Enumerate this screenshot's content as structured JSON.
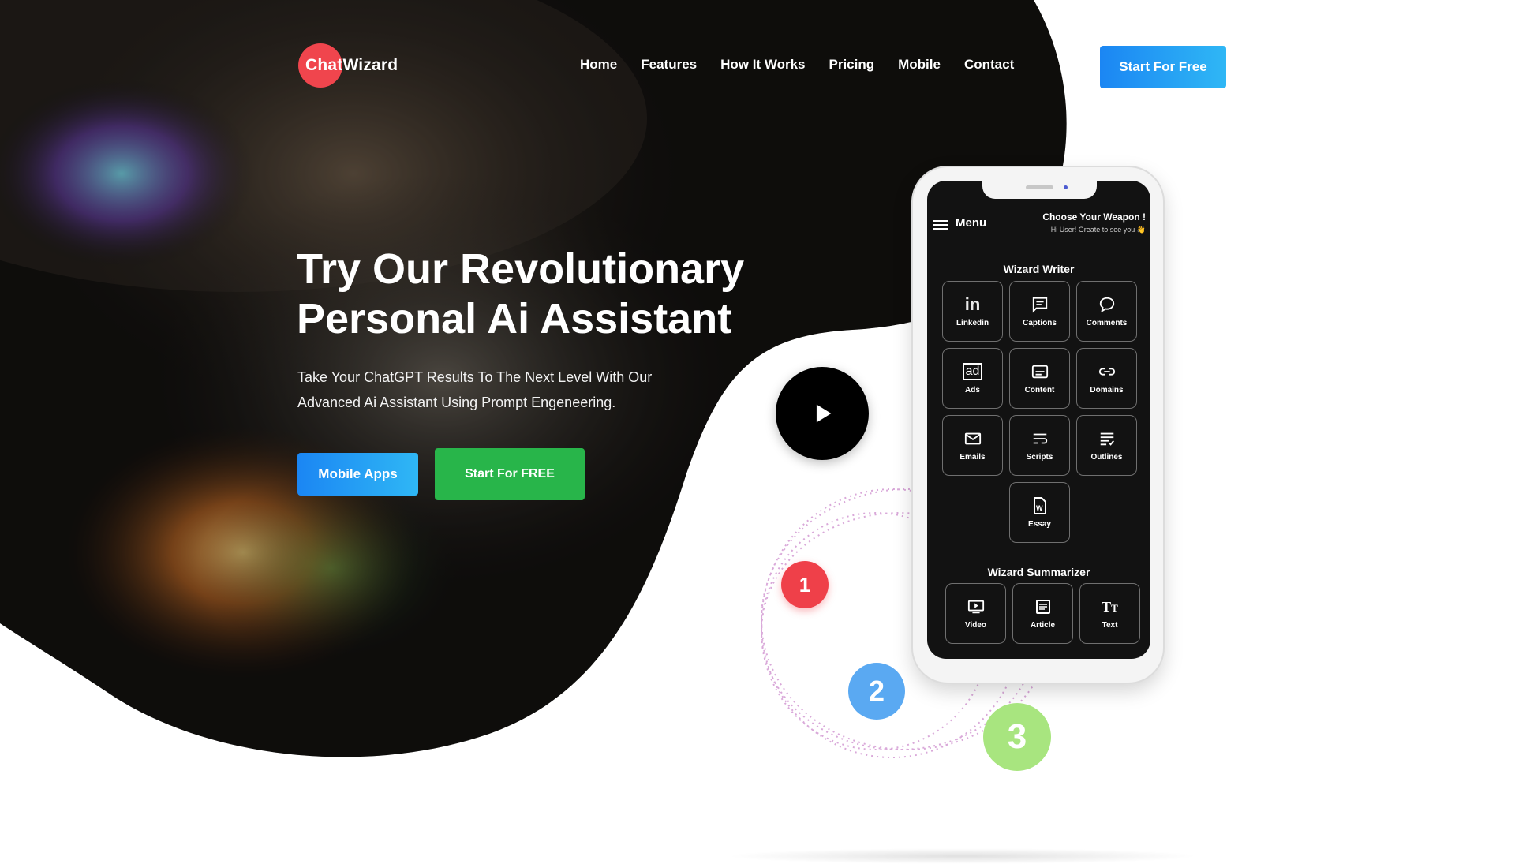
{
  "brand": {
    "name": "ChatWizard",
    "accent": "#f0454d"
  },
  "nav": {
    "items": [
      {
        "label": "Home"
      },
      {
        "label": "Features"
      },
      {
        "label": "How It Works"
      },
      {
        "label": "Pricing"
      },
      {
        "label": "Mobile"
      },
      {
        "label": "Contact"
      }
    ],
    "cta_label": "Start For Free"
  },
  "hero": {
    "title_line1": "Try Our Revolutionary",
    "title_line2": "Personal Ai Assistant",
    "subtitle_line1": "Take Your ChatGPT Results To The Next Level With Our",
    "subtitle_line2": "Advanced Ai Assistant Using Prompt Engeneering.",
    "btn_mobile": "Mobile Apps",
    "btn_free": "Start For FREE"
  },
  "steps": [
    "1",
    "2",
    "3"
  ],
  "phone": {
    "menu_label": "Menu",
    "choose_label": "Choose Your Weapon !",
    "greeting": "Hi User! Greate to see you 👋",
    "writer_title": "Wizard Writer",
    "writer_tools": [
      {
        "label": "Linkedin",
        "icon": "linkedin-icon"
      },
      {
        "label": "Captions",
        "icon": "captions-icon"
      },
      {
        "label": "Comments",
        "icon": "comments-icon"
      },
      {
        "label": "Ads",
        "icon": "ads-icon"
      },
      {
        "label": "Content",
        "icon": "content-icon"
      },
      {
        "label": "Domains",
        "icon": "domains-icon"
      },
      {
        "label": "Emails",
        "icon": "email-icon"
      },
      {
        "label": "Scripts",
        "icon": "scripts-icon"
      },
      {
        "label": "Outlines",
        "icon": "outlines-icon"
      },
      {
        "label": "Essay",
        "icon": "essay-icon"
      }
    ],
    "summarizer_title": "Wizard Summarizer",
    "summarizer_tools": [
      {
        "label": "Video",
        "icon": "video-icon"
      },
      {
        "label": "Article",
        "icon": "article-icon"
      },
      {
        "label": "Text",
        "icon": "text-icon"
      }
    ]
  },
  "colors": {
    "primary_blue": "#1b86f3",
    "green": "#28b54a",
    "step1": "#ef4049",
    "step2": "#5aa9f2",
    "step3": "#a8e57f"
  }
}
